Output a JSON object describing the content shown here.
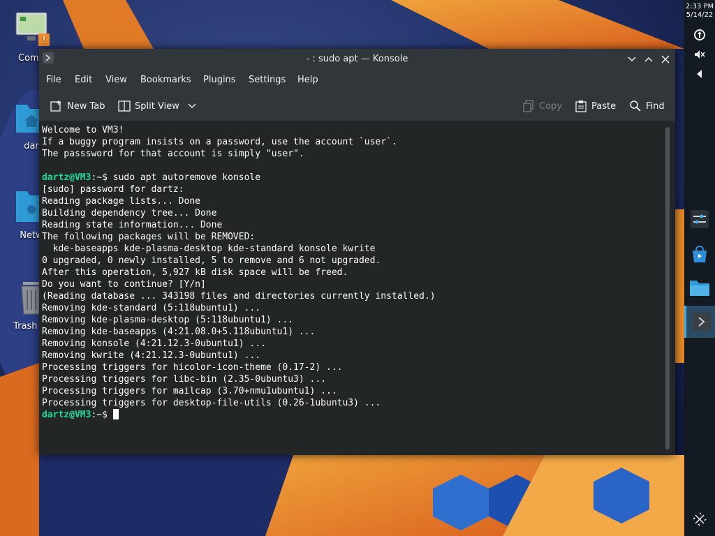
{
  "desktop": {
    "icons": [
      {
        "label": "Comp"
      },
      {
        "label": "dar"
      },
      {
        "label": "Netw"
      },
      {
        "label": "Trash (E"
      }
    ]
  },
  "panel": {
    "time": "2:33 PM",
    "date": "5/14/22"
  },
  "window": {
    "title": "- : sudo apt — Konsole",
    "menu": [
      "File",
      "Edit",
      "View",
      "Bookmarks",
      "Plugins",
      "Settings",
      "Help"
    ],
    "toolbar": {
      "new_tab": "New Tab",
      "split_view": "Split View",
      "copy": "Copy",
      "paste": "Paste",
      "find": "Find"
    }
  },
  "terminal": {
    "prompt": "dartz@VM3",
    "prompt_suffix": ":~$ ",
    "command": "sudo apt autoremove konsole",
    "intro": [
      "Welcome to VM3!",
      "If a buggy program insists on a password, use the account `user`.",
      "The passsword for that account is simply \"user\"."
    ],
    "output": [
      "[sudo] password for dartz:",
      "Reading package lists... Done",
      "Building dependency tree... Done",
      "Reading state information... Done",
      "The following packages will be REMOVED:",
      "  kde-baseapps kde-plasma-desktop kde-standard konsole kwrite",
      "0 upgraded, 0 newly installed, 5 to remove and 6 not upgraded.",
      "After this operation, 5,927 kB disk space will be freed.",
      "Do you want to continue? [Y/n]",
      "(Reading database ... 343198 files and directories currently installed.)",
      "Removing kde-standard (5:118ubuntu1) ...",
      "Removing kde-plasma-desktop (5:118ubuntu1) ...",
      "Removing kde-baseapps (4:21.08.0+5.118ubuntu1) ...",
      "Removing konsole (4:21.12.3-0ubuntu1) ...",
      "Removing kwrite (4:21.12.3-0ubuntu1) ...",
      "Processing triggers for hicolor-icon-theme (0.17-2) ...",
      "Processing triggers for libc-bin (2.35-0ubuntu3) ...",
      "Processing triggers for mailcap (3.70+nmu1ubuntu1) ...",
      "Processing triggers for desktop-file-utils (0.26-1ubuntu3) ..."
    ]
  },
  "colors": {
    "prompt": "#1cdc9a",
    "accent": "#3daee9",
    "terminal_bg": "#232627"
  }
}
